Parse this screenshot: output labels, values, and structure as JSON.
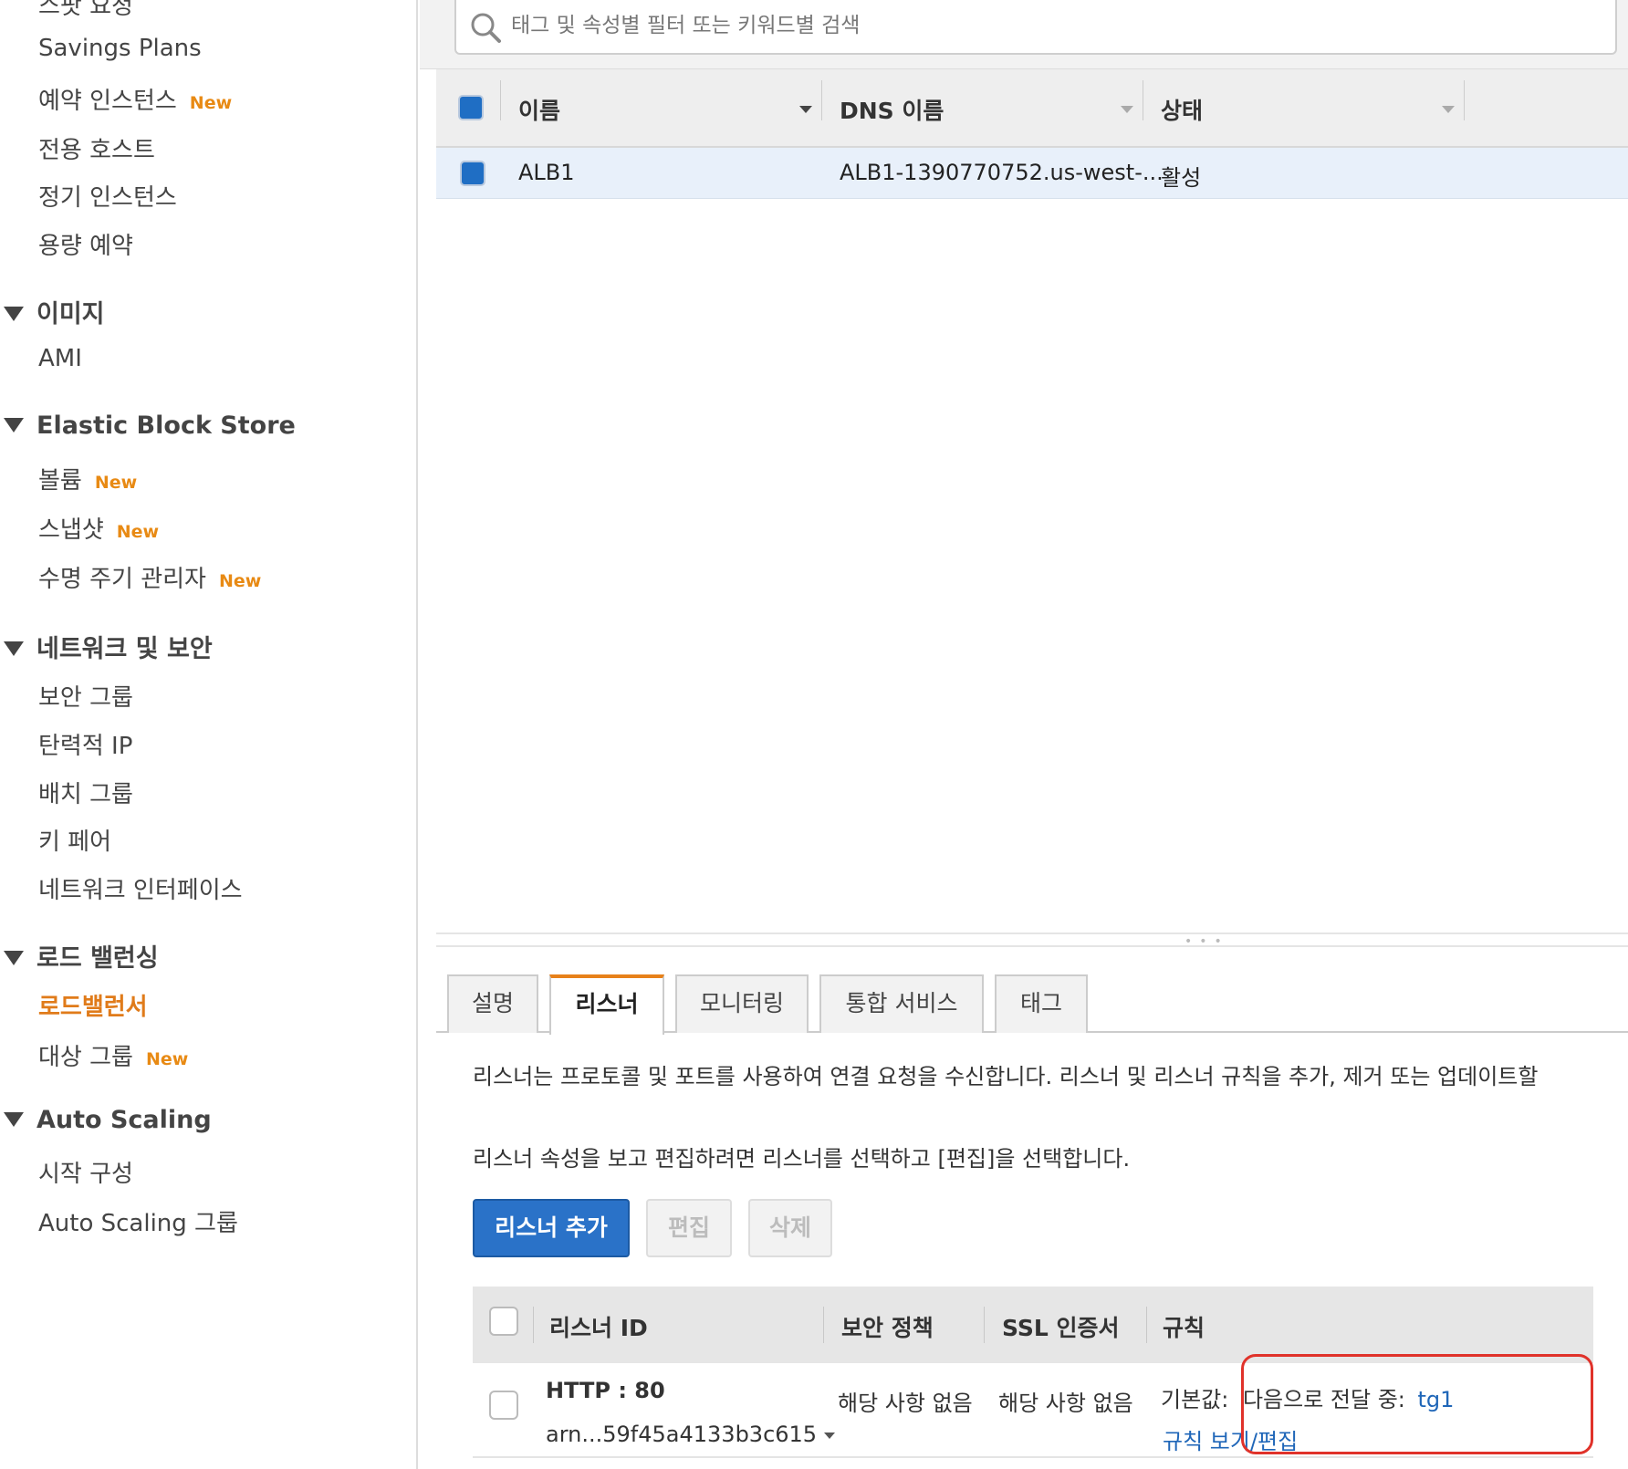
{
  "sidebar": {
    "clipped_item": "스팟 요청",
    "items_top": [
      {
        "label": "Savings Plans",
        "badge": ""
      },
      {
        "label": "예약 인스턴스",
        "badge": "New"
      },
      {
        "label": "전용 호스트",
        "badge": ""
      },
      {
        "label": "정기 인스턴스",
        "badge": ""
      },
      {
        "label": "용량 예약",
        "badge": ""
      }
    ],
    "sections": [
      {
        "title": "이미지",
        "items": [
          {
            "label": "AMI",
            "badge": ""
          }
        ]
      },
      {
        "title": "Elastic Block Store",
        "items": [
          {
            "label": "볼륨",
            "badge": "New"
          },
          {
            "label": "스냅샷",
            "badge": "New"
          },
          {
            "label": "수명 주기 관리자",
            "badge": "New"
          }
        ]
      },
      {
        "title": "네트워크 및 보안",
        "items": [
          {
            "label": "보안 그룹",
            "badge": ""
          },
          {
            "label": "탄력적 IP",
            "badge": ""
          },
          {
            "label": "배치 그룹",
            "badge": ""
          },
          {
            "label": "키 페어",
            "badge": ""
          },
          {
            "label": "네트워크 인터페이스",
            "badge": ""
          }
        ]
      },
      {
        "title": "로드 밸런싱",
        "items": [
          {
            "label": "로드밸런서",
            "badge": "",
            "active": true
          },
          {
            "label": "대상 그룹",
            "badge": "New"
          }
        ]
      },
      {
        "title": "Auto Scaling",
        "items": [
          {
            "label": "시작 구성",
            "badge": ""
          },
          {
            "label": "Auto Scaling 그룹",
            "badge": ""
          }
        ]
      }
    ]
  },
  "search": {
    "placeholder": "태그 및 속성별 필터 또는 키워드별 검색"
  },
  "lb_table": {
    "columns": [
      "이름",
      "DNS 이름",
      "상태"
    ],
    "rows": [
      {
        "name": "ALB1",
        "dns": "ALB1-1390770752.us-west-...",
        "state": "활성"
      }
    ]
  },
  "tabs": [
    "설명",
    "리스너",
    "모니터링",
    "통합 서비스",
    "태그"
  ],
  "active_tab": "리스너",
  "listener_panel": {
    "desc1": "리스너는 프로토콜 및 포트를 사용하여 연결 요청을 수신합니다. 리스너 및 리스너 규칙을 추가, 제거 또는 업데이트할",
    "desc2": "리스너 속성을 보고 편집하려면 리스너를 선택하고 [편집]을 선택합니다.",
    "buttons": {
      "add": "리스너 추가",
      "edit": "편집",
      "delete": "삭제"
    },
    "table": {
      "columns": [
        "리스너 ID",
        "보안 정책",
        "SSL 인증서",
        "규칙"
      ],
      "rows": [
        {
          "listener": "HTTP : 80",
          "arn": "arn...59f45a4133b3c615",
          "security_policy": "해당 사항 없음",
          "ssl_cert": "해당 사항 없음",
          "rule_default_label": "기본값:",
          "rule_forward_text": "다음으로 전달 중:",
          "rule_target": "tg1",
          "rule_view_edit": "규칙 보기/편집"
        }
      ]
    }
  },
  "colors": {
    "accent": "#e7811a",
    "primary": "#2a72c8",
    "link": "#1f66b8",
    "highlight": "#e0322a"
  }
}
